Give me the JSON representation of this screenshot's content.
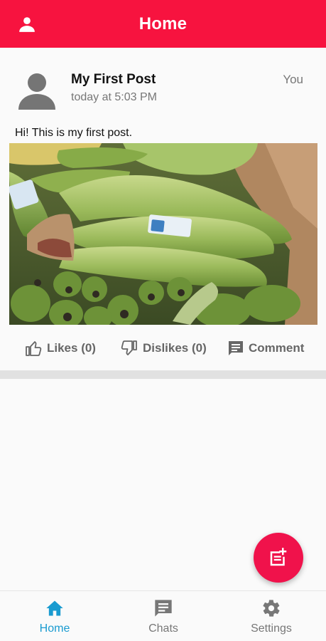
{
  "header": {
    "title": "Home"
  },
  "post": {
    "author": "My First Post",
    "timestamp": "today at 5:03 PM",
    "owner": "You",
    "text": "Hi! This is my first post."
  },
  "actions": {
    "likes_label": "Likes (0)",
    "dislikes_label": "Dislikes (0)",
    "comment_label": "Comment"
  },
  "bottom_nav": {
    "items": [
      {
        "label": "Home",
        "icon": "home-icon",
        "active": true
      },
      {
        "label": "Chats",
        "icon": "chat-icon",
        "active": false
      },
      {
        "label": "Settings",
        "icon": "gear-icon",
        "active": false
      }
    ]
  },
  "colors": {
    "appbar": "#f7133f",
    "fab": "#f0124b",
    "active_nav": "#1a9bd0",
    "inactive": "#777777"
  }
}
